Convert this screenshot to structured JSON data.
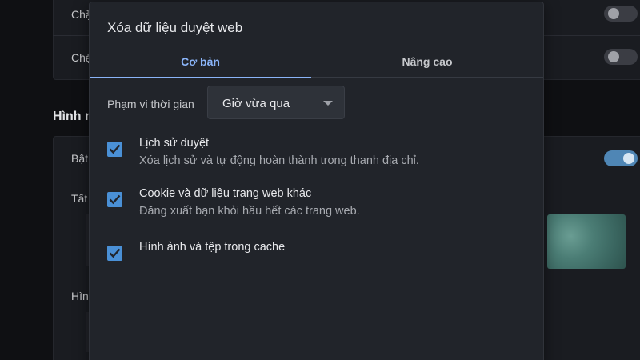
{
  "background": {
    "rows": [
      {
        "label": "Chặ"
      },
      {
        "label": "Chặ"
      }
    ],
    "section_heading": "Hình n",
    "mid_rows": [
      {
        "label": "Bật"
      },
      {
        "label": "Tất"
      },
      {
        "label": "Hìn"
      }
    ]
  },
  "dialog": {
    "title": "Xóa dữ liệu duyệt web",
    "tabs": [
      {
        "label": "Cơ bản"
      },
      {
        "label": "Nâng cao"
      }
    ],
    "time_range": {
      "label": "Phạm vi thời gian",
      "selected": "Giờ vừa qua"
    },
    "options": [
      {
        "title": "Lịch sử duyệt",
        "description": "Xóa lịch sử và tự động hoàn thành trong thanh địa chỉ.",
        "checked": true
      },
      {
        "title": "Cookie và dữ liệu trang web khác",
        "description": "Đăng xuất bạn khỏi hầu hết các trang web.",
        "checked": true
      },
      {
        "title": "Hình ảnh và tệp trong cache",
        "description": "",
        "checked": true
      }
    ]
  },
  "colors": {
    "accent": "#8ab4f8",
    "checkbox": "#4a90d6",
    "dialog_bg": "#21242a"
  }
}
